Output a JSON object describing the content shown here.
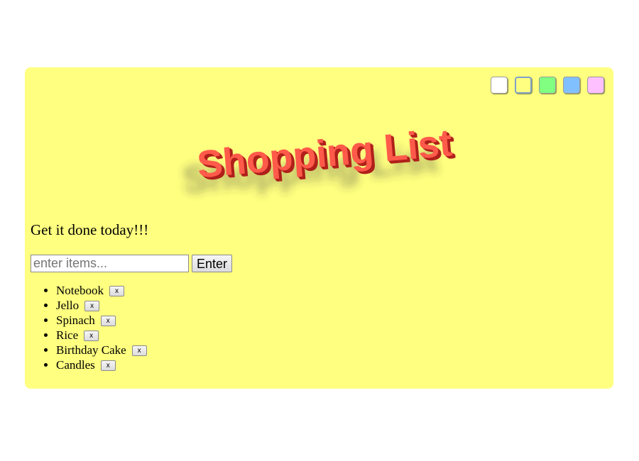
{
  "swatches": [
    {
      "color": "#ffffff",
      "selected": false
    },
    {
      "color": "#ffff80",
      "selected": true
    },
    {
      "color": "#80ff80",
      "selected": false
    },
    {
      "color": "#80c0ff",
      "selected": false
    },
    {
      "color": "#ffc0ff",
      "selected": false
    }
  ],
  "title": "Shopping List",
  "colors": {
    "background": "#ffff80",
    "title_face": "#ff5a4a",
    "title_side": "#b0201a"
  },
  "tagline": "Get it done today!!!",
  "input": {
    "placeholder": "enter items...",
    "value": ""
  },
  "enter_label": "Enter",
  "delete_label": "x",
  "items": [
    "Notebook",
    "Jello",
    "Spinach",
    "Rice",
    "Birthday Cake",
    "Candles"
  ]
}
